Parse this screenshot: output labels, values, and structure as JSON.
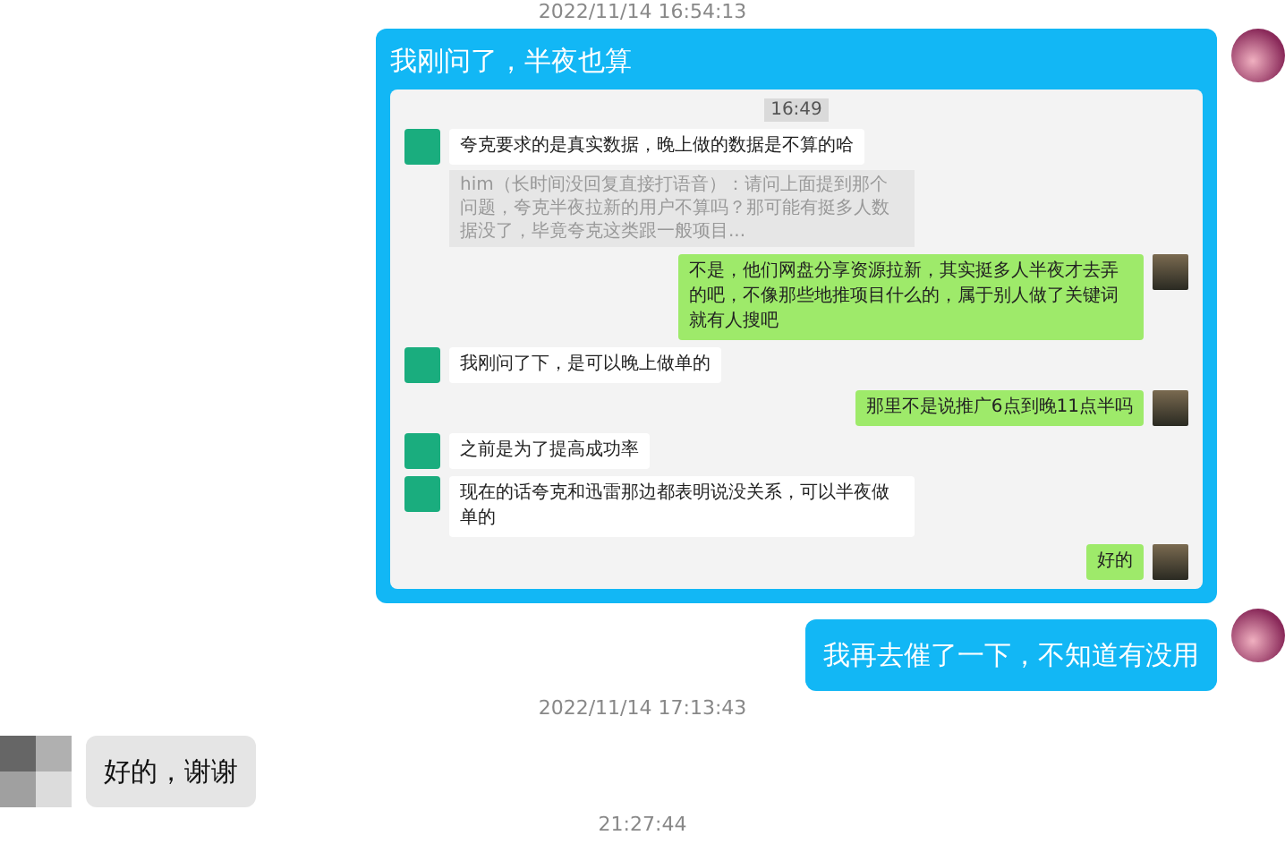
{
  "messages": [
    {
      "kind": "time",
      "text": "2022/11/14 16:54:13"
    },
    {
      "kind": "screenshot",
      "outgoing": true,
      "text": "我刚问了，半夜也算",
      "screenshot": {
        "time": "16:49",
        "messages": [
          {
            "outgoing": false,
            "text": "夸克要求的是真实数据，晚上做的数据是不算的哈",
            "quote": "him（长时间没回复直接打语音）：请问上面提到那个问题，夸克半夜拉新的用户不算吗？那可能有挺多人数据没了，毕竟夸克这类跟一般项目..."
          },
          {
            "outgoing": true,
            "text": "不是，他们网盘分享资源拉新，其实挺多人半夜才去弄的吧，不像那些地推项目什么的，属于别人做了关键词就有人搜吧"
          },
          {
            "outgoing": false,
            "text": "我刚问了下，是可以晚上做单的"
          },
          {
            "outgoing": true,
            "text": "那里不是说推广6点到晚11点半吗"
          },
          {
            "outgoing": false,
            "text": "之前是为了提高成功率"
          },
          {
            "outgoing": false,
            "text": "现在的话夸克和迅雷那边都表明说没关系，可以半夜做单的"
          },
          {
            "outgoing": true,
            "text": "好的"
          }
        ]
      }
    },
    {
      "kind": "text",
      "outgoing": true,
      "text": "我再去催了一下，不知道有没用"
    },
    {
      "kind": "time",
      "text": "2022/11/14 17:13:43"
    },
    {
      "kind": "text",
      "outgoing": false,
      "text": "好的，谢谢"
    },
    {
      "kind": "time",
      "text": "21:27:44"
    }
  ]
}
